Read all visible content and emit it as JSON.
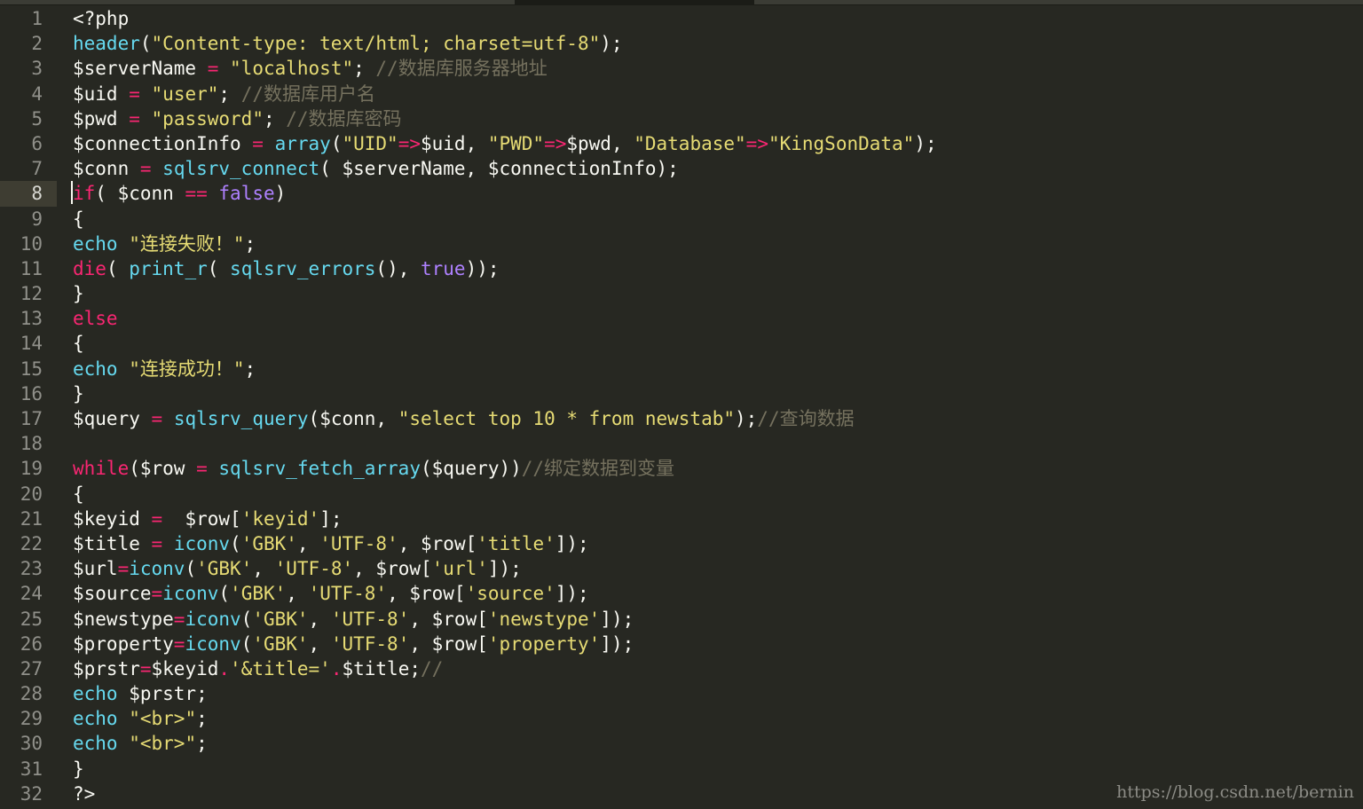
{
  "editor": {
    "active_line": 8,
    "colors": {
      "background": "#272822",
      "plain": "#f8f8f2",
      "string": "#e6db74",
      "keyword": "#f92672",
      "function": "#66d9ef",
      "constant": "#ae81ff",
      "comment": "#75715e"
    },
    "lines": [
      {
        "no": "1",
        "tokens": [
          {
            "t": "<?php",
            "c": "plain"
          }
        ]
      },
      {
        "no": "2",
        "tokens": [
          {
            "t": "header",
            "c": "fn"
          },
          {
            "t": "(",
            "c": "plain"
          },
          {
            "t": "\"Content-type: text/html; charset=utf-8\"",
            "c": "str"
          },
          {
            "t": ");",
            "c": "plain"
          }
        ]
      },
      {
        "no": "3",
        "tokens": [
          {
            "t": "$serverName ",
            "c": "plain"
          },
          {
            "t": "=",
            "c": "kw"
          },
          {
            "t": " ",
            "c": "plain"
          },
          {
            "t": "\"localhost\"",
            "c": "str"
          },
          {
            "t": "; ",
            "c": "plain"
          },
          {
            "t": "//数据库服务器地址",
            "c": "cm"
          }
        ]
      },
      {
        "no": "4",
        "tokens": [
          {
            "t": "$uid ",
            "c": "plain"
          },
          {
            "t": "=",
            "c": "kw"
          },
          {
            "t": " ",
            "c": "plain"
          },
          {
            "t": "\"user\"",
            "c": "str"
          },
          {
            "t": "; ",
            "c": "plain"
          },
          {
            "t": "//数据库用户名",
            "c": "cm"
          }
        ]
      },
      {
        "no": "5",
        "tokens": [
          {
            "t": "$pwd ",
            "c": "plain"
          },
          {
            "t": "=",
            "c": "kw"
          },
          {
            "t": " ",
            "c": "plain"
          },
          {
            "t": "\"password\"",
            "c": "str"
          },
          {
            "t": "; ",
            "c": "plain"
          },
          {
            "t": "//数据库密码",
            "c": "cm"
          }
        ]
      },
      {
        "no": "6",
        "tokens": [
          {
            "t": "$connectionInfo ",
            "c": "plain"
          },
          {
            "t": "=",
            "c": "kw"
          },
          {
            "t": " ",
            "c": "plain"
          },
          {
            "t": "array",
            "c": "fn"
          },
          {
            "t": "(",
            "c": "plain"
          },
          {
            "t": "\"UID\"",
            "c": "str"
          },
          {
            "t": "=>",
            "c": "kw"
          },
          {
            "t": "$uid, ",
            "c": "plain"
          },
          {
            "t": "\"PWD\"",
            "c": "str"
          },
          {
            "t": "=>",
            "c": "kw"
          },
          {
            "t": "$pwd, ",
            "c": "plain"
          },
          {
            "t": "\"Database\"",
            "c": "str"
          },
          {
            "t": "=>",
            "c": "kw"
          },
          {
            "t": "\"KingSonData\"",
            "c": "str"
          },
          {
            "t": ");",
            "c": "plain"
          }
        ]
      },
      {
        "no": "7",
        "tokens": [
          {
            "t": "$conn ",
            "c": "plain"
          },
          {
            "t": "=",
            "c": "kw"
          },
          {
            "t": " ",
            "c": "plain"
          },
          {
            "t": "sqlsrv_connect",
            "c": "fn"
          },
          {
            "t": "( $serverName, $connectionInfo);",
            "c": "plain"
          }
        ]
      },
      {
        "no": "8",
        "tokens": [
          {
            "t": "if",
            "c": "kw"
          },
          {
            "t": "( $conn ",
            "c": "plain"
          },
          {
            "t": "==",
            "c": "kw"
          },
          {
            "t": " ",
            "c": "plain"
          },
          {
            "t": "false",
            "c": "const"
          },
          {
            "t": ")",
            "c": "plain"
          }
        ]
      },
      {
        "no": "9",
        "tokens": [
          {
            "t": "{",
            "c": "plain"
          }
        ]
      },
      {
        "no": "10",
        "tokens": [
          {
            "t": "echo",
            "c": "fn"
          },
          {
            "t": " ",
            "c": "plain"
          },
          {
            "t": "\"连接失败！\"",
            "c": "str"
          },
          {
            "t": ";",
            "c": "plain"
          }
        ]
      },
      {
        "no": "11",
        "tokens": [
          {
            "t": "die",
            "c": "kw"
          },
          {
            "t": "( ",
            "c": "plain"
          },
          {
            "t": "print_r",
            "c": "fn"
          },
          {
            "t": "( ",
            "c": "plain"
          },
          {
            "t": "sqlsrv_errors",
            "c": "fn"
          },
          {
            "t": "(), ",
            "c": "plain"
          },
          {
            "t": "true",
            "c": "const"
          },
          {
            "t": "));",
            "c": "plain"
          }
        ]
      },
      {
        "no": "12",
        "tokens": [
          {
            "t": "}",
            "c": "plain"
          }
        ]
      },
      {
        "no": "13",
        "tokens": [
          {
            "t": "else",
            "c": "kw"
          }
        ]
      },
      {
        "no": "14",
        "tokens": [
          {
            "t": "{",
            "c": "plain"
          }
        ]
      },
      {
        "no": "15",
        "tokens": [
          {
            "t": "echo",
            "c": "fn"
          },
          {
            "t": " ",
            "c": "plain"
          },
          {
            "t": "\"连接成功！\"",
            "c": "str"
          },
          {
            "t": ";",
            "c": "plain"
          }
        ]
      },
      {
        "no": "16",
        "tokens": [
          {
            "t": "}",
            "c": "plain"
          }
        ]
      },
      {
        "no": "17",
        "tokens": [
          {
            "t": "$query ",
            "c": "plain"
          },
          {
            "t": "=",
            "c": "kw"
          },
          {
            "t": " ",
            "c": "plain"
          },
          {
            "t": "sqlsrv_query",
            "c": "fn"
          },
          {
            "t": "($conn, ",
            "c": "plain"
          },
          {
            "t": "\"select top 10 * from newstab\"",
            "c": "str"
          },
          {
            "t": ");",
            "c": "plain"
          },
          {
            "t": "//查询数据",
            "c": "cm"
          }
        ]
      },
      {
        "no": "18",
        "tokens": []
      },
      {
        "no": "19",
        "tokens": [
          {
            "t": "while",
            "c": "kw"
          },
          {
            "t": "($row ",
            "c": "plain"
          },
          {
            "t": "=",
            "c": "kw"
          },
          {
            "t": " ",
            "c": "plain"
          },
          {
            "t": "sqlsrv_fetch_array",
            "c": "fn"
          },
          {
            "t": "($query))",
            "c": "plain"
          },
          {
            "t": "//绑定数据到变量",
            "c": "cm"
          }
        ]
      },
      {
        "no": "20",
        "tokens": [
          {
            "t": "{",
            "c": "plain"
          }
        ]
      },
      {
        "no": "21",
        "tokens": [
          {
            "t": "$keyid ",
            "c": "plain"
          },
          {
            "t": "=",
            "c": "kw"
          },
          {
            "t": "  $row[",
            "c": "plain"
          },
          {
            "t": "'keyid'",
            "c": "str"
          },
          {
            "t": "];",
            "c": "plain"
          }
        ]
      },
      {
        "no": "22",
        "tokens": [
          {
            "t": "$title ",
            "c": "plain"
          },
          {
            "t": "=",
            "c": "kw"
          },
          {
            "t": " ",
            "c": "plain"
          },
          {
            "t": "iconv",
            "c": "fn"
          },
          {
            "t": "(",
            "c": "plain"
          },
          {
            "t": "'GBK'",
            "c": "str"
          },
          {
            "t": ", ",
            "c": "plain"
          },
          {
            "t": "'UTF-8'",
            "c": "str"
          },
          {
            "t": ", $row[",
            "c": "plain"
          },
          {
            "t": "'title'",
            "c": "str"
          },
          {
            "t": "]);",
            "c": "plain"
          }
        ]
      },
      {
        "no": "23",
        "tokens": [
          {
            "t": "$url",
            "c": "plain"
          },
          {
            "t": "=",
            "c": "kw"
          },
          {
            "t": "iconv",
            "c": "fn"
          },
          {
            "t": "(",
            "c": "plain"
          },
          {
            "t": "'GBK'",
            "c": "str"
          },
          {
            "t": ", ",
            "c": "plain"
          },
          {
            "t": "'UTF-8'",
            "c": "str"
          },
          {
            "t": ", $row[",
            "c": "plain"
          },
          {
            "t": "'url'",
            "c": "str"
          },
          {
            "t": "]);",
            "c": "plain"
          }
        ]
      },
      {
        "no": "24",
        "tokens": [
          {
            "t": "$source",
            "c": "plain"
          },
          {
            "t": "=",
            "c": "kw"
          },
          {
            "t": "iconv",
            "c": "fn"
          },
          {
            "t": "(",
            "c": "plain"
          },
          {
            "t": "'GBK'",
            "c": "str"
          },
          {
            "t": ", ",
            "c": "plain"
          },
          {
            "t": "'UTF-8'",
            "c": "str"
          },
          {
            "t": ", $row[",
            "c": "plain"
          },
          {
            "t": "'source'",
            "c": "str"
          },
          {
            "t": "]);",
            "c": "plain"
          }
        ]
      },
      {
        "no": "25",
        "tokens": [
          {
            "t": "$newstype",
            "c": "plain"
          },
          {
            "t": "=",
            "c": "kw"
          },
          {
            "t": "iconv",
            "c": "fn"
          },
          {
            "t": "(",
            "c": "plain"
          },
          {
            "t": "'GBK'",
            "c": "str"
          },
          {
            "t": ", ",
            "c": "plain"
          },
          {
            "t": "'UTF-8'",
            "c": "str"
          },
          {
            "t": ", $row[",
            "c": "plain"
          },
          {
            "t": "'newstype'",
            "c": "str"
          },
          {
            "t": "]);",
            "c": "plain"
          }
        ]
      },
      {
        "no": "26",
        "tokens": [
          {
            "t": "$property",
            "c": "plain"
          },
          {
            "t": "=",
            "c": "kw"
          },
          {
            "t": "iconv",
            "c": "fn"
          },
          {
            "t": "(",
            "c": "plain"
          },
          {
            "t": "'GBK'",
            "c": "str"
          },
          {
            "t": ", ",
            "c": "plain"
          },
          {
            "t": "'UTF-8'",
            "c": "str"
          },
          {
            "t": ", $row[",
            "c": "plain"
          },
          {
            "t": "'property'",
            "c": "str"
          },
          {
            "t": "]);",
            "c": "plain"
          }
        ]
      },
      {
        "no": "27",
        "tokens": [
          {
            "t": "$prstr",
            "c": "plain"
          },
          {
            "t": "=",
            "c": "kw"
          },
          {
            "t": "$keyid",
            "c": "plain"
          },
          {
            "t": ".",
            "c": "kw"
          },
          {
            "t": "'&title='",
            "c": "str"
          },
          {
            "t": ".",
            "c": "kw"
          },
          {
            "t": "$title;",
            "c": "plain"
          },
          {
            "t": "//",
            "c": "cm"
          }
        ]
      },
      {
        "no": "28",
        "tokens": [
          {
            "t": "echo",
            "c": "fn"
          },
          {
            "t": " $prstr;",
            "c": "plain"
          }
        ]
      },
      {
        "no": "29",
        "tokens": [
          {
            "t": "echo",
            "c": "fn"
          },
          {
            "t": " ",
            "c": "plain"
          },
          {
            "t": "\"<br>\"",
            "c": "str"
          },
          {
            "t": ";",
            "c": "plain"
          }
        ]
      },
      {
        "no": "30",
        "tokens": [
          {
            "t": "echo",
            "c": "fn"
          },
          {
            "t": " ",
            "c": "plain"
          },
          {
            "t": "\"<br>\"",
            "c": "str"
          },
          {
            "t": ";",
            "c": "plain"
          }
        ]
      },
      {
        "no": "31",
        "tokens": [
          {
            "t": "}",
            "c": "plain"
          }
        ]
      },
      {
        "no": "32",
        "tokens": [
          {
            "t": "?>",
            "c": "plain"
          }
        ]
      }
    ]
  },
  "watermark": "https://blog.csdn.net/bernin"
}
